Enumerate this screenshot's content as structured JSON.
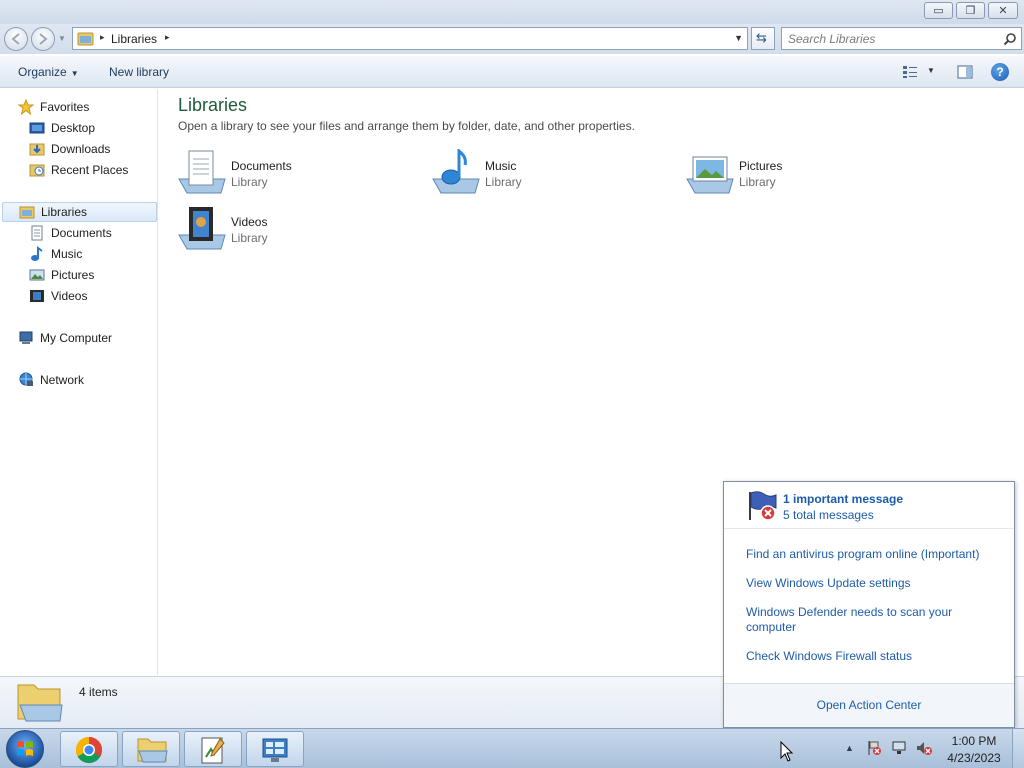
{
  "window": {
    "buttons": {
      "minimize": "▭",
      "restore": "❐",
      "close": "✕"
    }
  },
  "address": {
    "crumb": "Libraries",
    "separator": "▸"
  },
  "search": {
    "placeholder": "Search Libraries"
  },
  "toolbar": {
    "organize_label": "Organize",
    "new_library_label": "New library",
    "help_label": "?"
  },
  "nav": {
    "favorites": {
      "label": "Favorites",
      "items": [
        {
          "label": "Desktop",
          "icon": "desktop-icon"
        },
        {
          "label": "Downloads",
          "icon": "downloads-icon"
        },
        {
          "label": "Recent Places",
          "icon": "recent-places-icon"
        }
      ]
    },
    "libraries": {
      "label": "Libraries",
      "items": [
        {
          "label": "Documents",
          "icon": "documents-icon"
        },
        {
          "label": "Music",
          "icon": "music-icon"
        },
        {
          "label": "Pictures",
          "icon": "pictures-icon"
        },
        {
          "label": "Videos",
          "icon": "videos-icon"
        }
      ]
    },
    "computer": {
      "label": "My Computer"
    },
    "network": {
      "label": "Network"
    }
  },
  "main": {
    "title": "Libraries",
    "subtitle": "Open a library to see your files and arrange them by folder, date, and other properties.",
    "libraries": [
      {
        "name": "Documents",
        "type": "Library",
        "icon": "documents-library-icon"
      },
      {
        "name": "Music",
        "type": "Library",
        "icon": "music-library-icon"
      },
      {
        "name": "Pictures",
        "type": "Library",
        "icon": "pictures-library-icon"
      },
      {
        "name": "Videos",
        "type": "Library",
        "icon": "videos-library-icon"
      }
    ]
  },
  "details": {
    "count": "4 items"
  },
  "action_center": {
    "headline": "1 important message",
    "subline": "5 total messages",
    "links": [
      "Find an antivirus program online (Important)",
      "View Windows Update settings",
      "Windows Defender needs to scan your computer",
      "Check Windows Firewall status"
    ],
    "footer": "Open Action Center"
  },
  "taskbar": {
    "pinned": [
      "chrome-icon",
      "explorer-icon",
      "notepad-icon",
      "control-panel-icon"
    ],
    "tray_arrow": "▲",
    "time": "1:00 PM",
    "date": "4/23/2023"
  }
}
